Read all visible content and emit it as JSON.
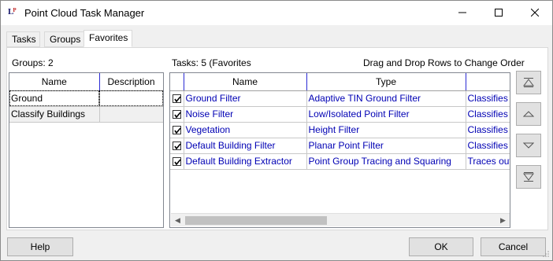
{
  "window": {
    "title": "Point Cloud Task Manager",
    "icon_text": "LP",
    "icon": "app-logo-icon"
  },
  "title_buttons": {
    "minimize_icon": "minimize-icon",
    "maximize_icon": "maximize-icon",
    "close_icon": "close-icon"
  },
  "tabs": [
    {
      "label": "Tasks"
    },
    {
      "label": "Groups"
    },
    {
      "label": "Favorites"
    }
  ],
  "active_tab": "Favorites",
  "groups_panel": {
    "count_label": "Groups: 2",
    "columns": [
      "Name",
      "Description"
    ],
    "rows": [
      {
        "name": "Ground",
        "description": ""
      },
      {
        "name": "Classify Buildings",
        "description": ""
      }
    ]
  },
  "tasks_panel": {
    "count_label": "Tasks: 5 (Favorites",
    "hint": "Drag and Drop Rows to Change Order",
    "columns": [
      "",
      "Name",
      "Type",
      ""
    ],
    "rows": [
      {
        "checked": true,
        "name": "Ground Filter",
        "type": "Adaptive TIN Ground Filter",
        "desc": "Classifies p"
      },
      {
        "checked": true,
        "name": "Noise Filter",
        "type": "Low/Isolated Point Filter",
        "desc": "Classifies n"
      },
      {
        "checked": true,
        "name": "Vegetation",
        "type": "Height Filter",
        "desc": "Classifies p"
      },
      {
        "checked": true,
        "name": "Default Building Filter",
        "type": "Planar Point Filter",
        "desc": "Classifies p"
      },
      {
        "checked": true,
        "name": "Default Building Extractor",
        "type": "Point Group Tracing and Squaring",
        "desc": "Traces out"
      }
    ]
  },
  "order_buttons": [
    "move-top-icon",
    "move-up-icon",
    "move-down-icon",
    "move-bottom-icon"
  ],
  "footer": {
    "help_label": "Help",
    "ok_label": "OK",
    "cancel_label": "Cancel"
  },
  "colors": {
    "link_text": "#0000b4",
    "header_divider": "#2b2bd4"
  }
}
